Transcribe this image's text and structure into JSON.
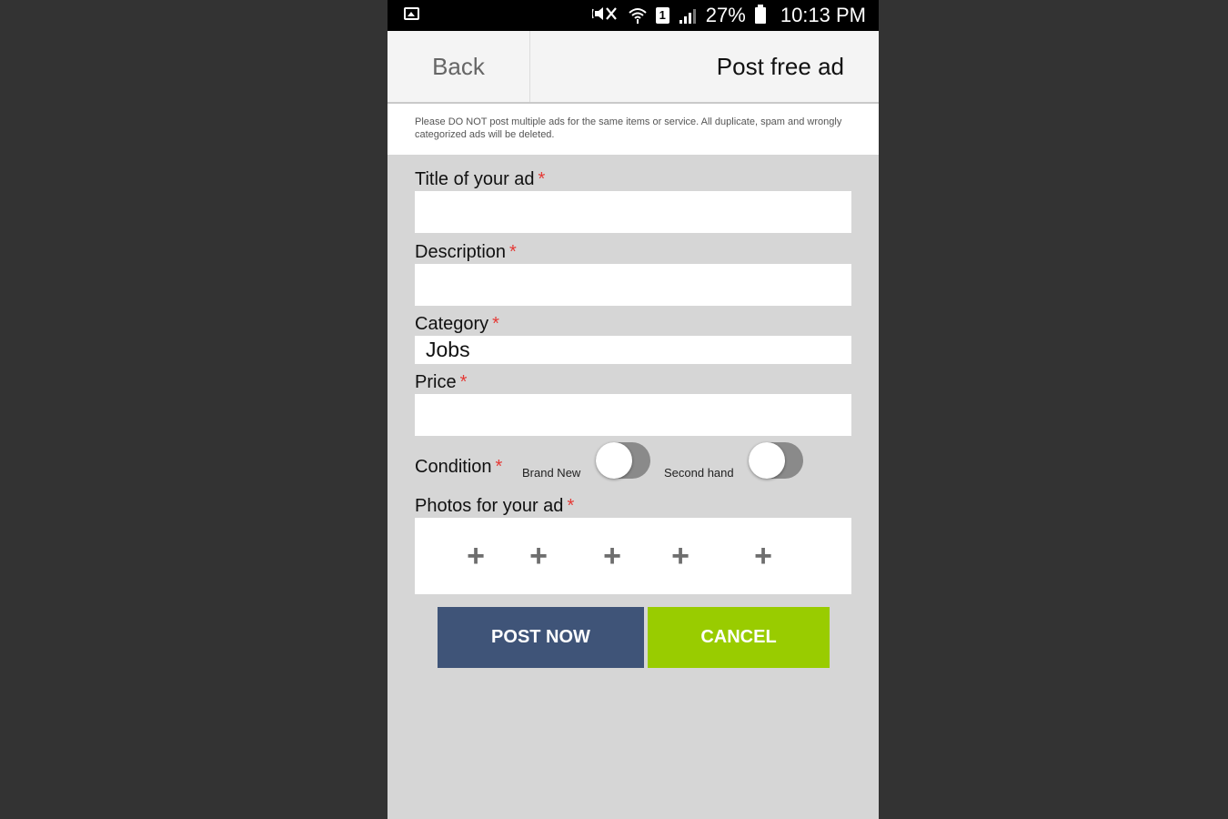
{
  "status_bar": {
    "icons": [
      "gallery-icon",
      "mute-icon",
      "wifi-icon",
      "sim-icon",
      "signal-icon",
      "battery-icon"
    ],
    "sim_slot": "1",
    "battery_percent": "27%",
    "time": "10:13 PM"
  },
  "header": {
    "back_label": "Back",
    "title": "Post free ad"
  },
  "notice": "Please DO NOT post multiple ads for the same items or service. All duplicate, spam and wrongly categorized ads will be deleted.",
  "form": {
    "required_marker": "*",
    "title": {
      "label": "Title of your ad",
      "value": ""
    },
    "description": {
      "label": "Description",
      "value": ""
    },
    "category": {
      "label": "Category",
      "value": "Jobs"
    },
    "price": {
      "label": "Price",
      "value": ""
    },
    "condition": {
      "label": "Condition",
      "options": [
        {
          "label": "Brand New",
          "on": false
        },
        {
          "label": "Second hand",
          "on": false
        }
      ]
    },
    "photos": {
      "label": "Photos for your ad",
      "slots": [
        "+",
        "+",
        "+",
        "+",
        "+"
      ]
    }
  },
  "buttons": {
    "post": "POST NOW",
    "cancel": "CANCEL"
  },
  "colors": {
    "post_button": "#3f5478",
    "cancel_button": "#99cc00",
    "required": "#e53935",
    "form_bg": "#d6d6d6"
  }
}
